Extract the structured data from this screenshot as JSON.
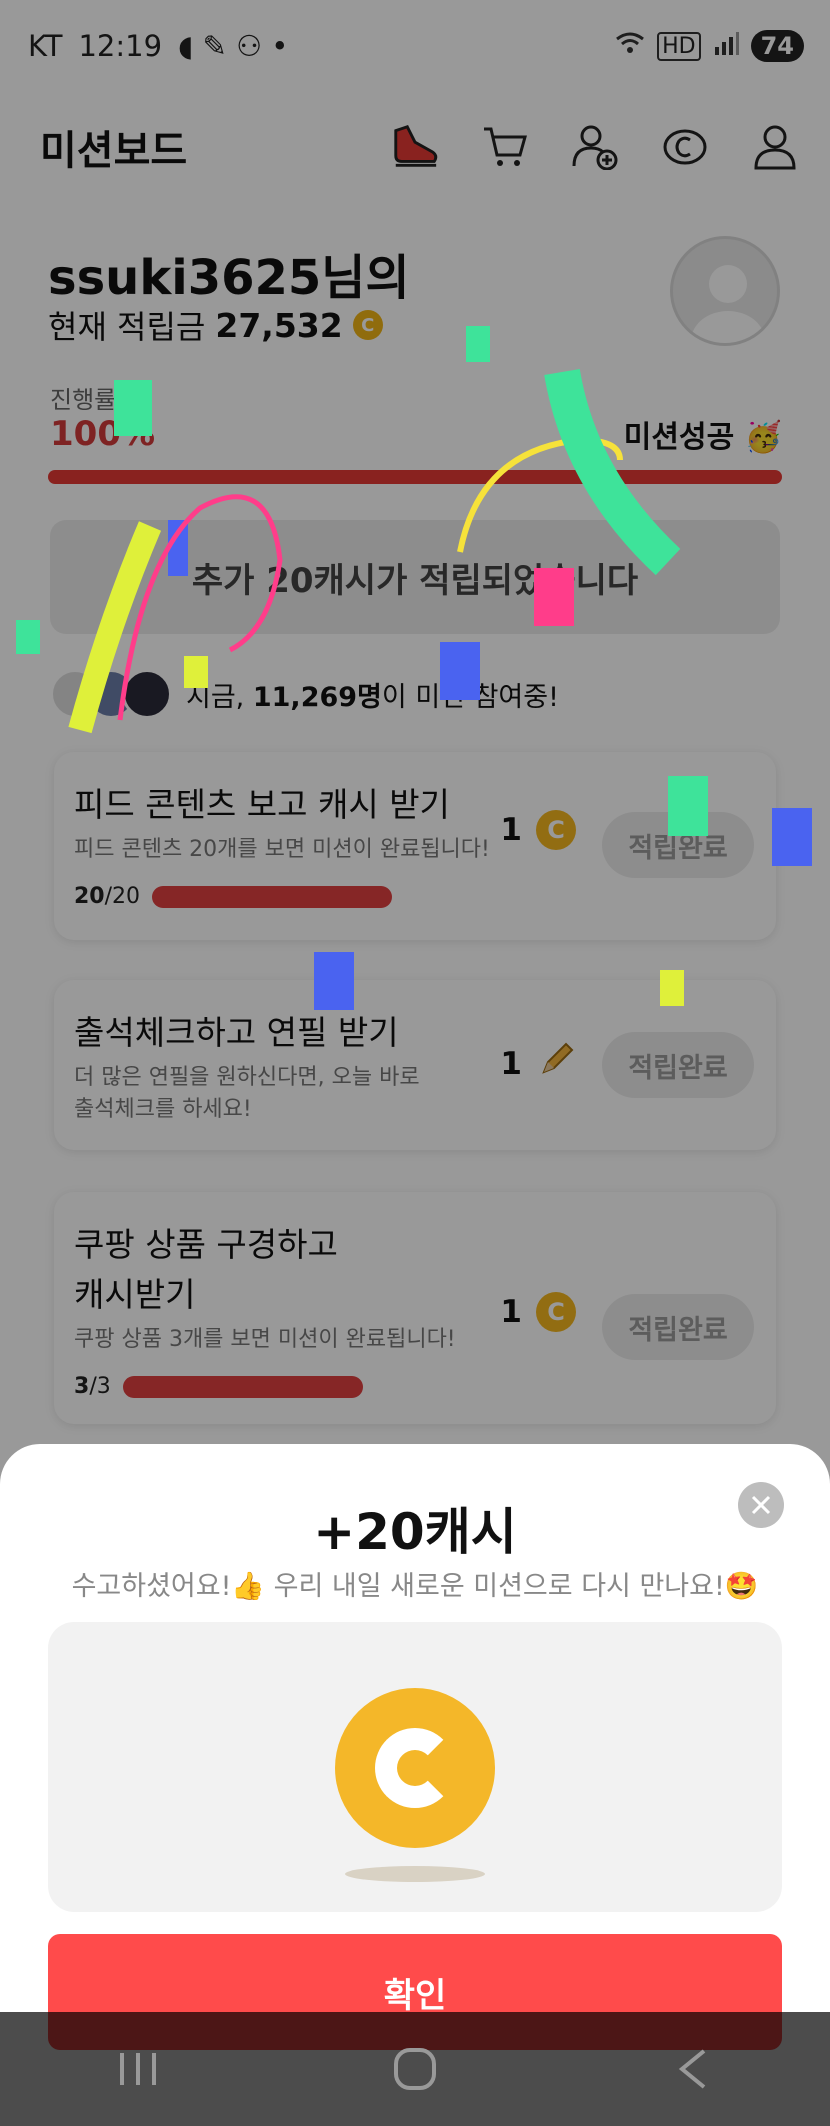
{
  "status_bar": {
    "carrier": "KT",
    "time": "12:19",
    "network": "HD",
    "battery": "74"
  },
  "app_bar": {
    "title": "미션보드",
    "icons": [
      "sneaker-icon",
      "cart-icon",
      "add-friend-icon",
      "cash-icon",
      "profile-icon"
    ]
  },
  "user": {
    "greeting": "ssuki3625님의",
    "balance_label": "현재 적립금",
    "balance": "27,532"
  },
  "progress": {
    "label": "진행률",
    "percent_text": "100%",
    "value": 1.0,
    "success_label": "미션성공"
  },
  "banner": {
    "text": "추가 20캐시가 적립되었습니다"
  },
  "participants": {
    "prefix": "지금,",
    "count": "11,269명",
    "suffix": "이 미션 참여중!"
  },
  "missions": [
    {
      "title": "피드 콘텐츠 보고 캐시 받기",
      "desc": "피드 콘텐츠 20개를 보면 미션이 완료됩니다!",
      "done": "20",
      "total": "/20",
      "progress": 1.0,
      "reward": "1",
      "reward_icon": "coin-icon",
      "button": "적립완료"
    },
    {
      "title": "출석체크하고 연필 받기",
      "desc": "더 많은 연필을 원하신다면, 오늘 바로 출석체크를 하세요!",
      "reward": "1",
      "reward_icon": "pencil-icon",
      "button": "적립완료"
    },
    {
      "title": "쿠팡 상품 구경하고 캐시받기",
      "desc": "쿠팡 상품 3개를 보면 미션이 완료됩니다!",
      "done": "3",
      "total": "/3",
      "progress": 1.0,
      "reward": "1",
      "reward_icon": "coin-icon",
      "button": "적립완료"
    }
  ],
  "sheet": {
    "title": "+20캐시",
    "subtitle": "수고하셨어요!👍 우리 내일 새로운 미션으로 다시 만나요!🤩",
    "confirm": "확인"
  },
  "colors": {
    "accent": "#ff4b4b",
    "coin": "#f4b729",
    "progress": "#e53935"
  }
}
